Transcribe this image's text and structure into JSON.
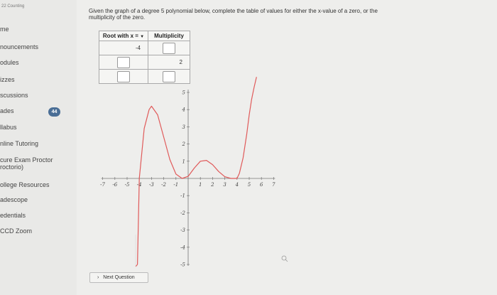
{
  "sidebar": {
    "course": "22 Counting",
    "items": [
      {
        "label": "me",
        "top": 36
      },
      {
        "label": "nouncements",
        "top": 61
      },
      {
        "label": "odules",
        "top": 83
      },
      {
        "label": "izzes",
        "top": 107
      },
      {
        "label": "scussions",
        "top": 129
      },
      {
        "label": "ades",
        "top": 151
      },
      {
        "label": "llabus",
        "top": 174
      },
      {
        "label": "nline Tutoring",
        "top": 197
      },
      {
        "label": "cure Exam Proctor",
        "top": 220
      },
      {
        "label": "roctorio)",
        "top": 230
      },
      {
        "label": "ollege Resources",
        "top": 255
      },
      {
        "label": "adescope",
        "top": 276
      },
      {
        "label": "edentials",
        "top": 298
      },
      {
        "label": "CCD Zoom",
        "top": 320
      }
    ],
    "grades_badge": "44"
  },
  "question": {
    "text": "Given the graph of a degree 5 polynomial below, complete the table of values for either the x-value of a zero, or the multiplicity of the zero."
  },
  "table": {
    "header_root": "Root with x =",
    "header_mult": "Multiplicity",
    "row1_root": "-4",
    "row2_mult": "2"
  },
  "chart_data": {
    "type": "line",
    "xlim": [
      -7,
      7
    ],
    "ylim": [
      -5,
      5
    ],
    "x_ticks": [
      "-7",
      "-6",
      "-5",
      "-4",
      "-3",
      "-2",
      "-1",
      "1",
      "2",
      "3",
      "4",
      "5",
      "6",
      "7"
    ],
    "y_ticks": [
      "5",
      "4",
      "3",
      "2",
      "1",
      "-1",
      "-2",
      "-3",
      "-4",
      "-5"
    ],
    "series": [
      {
        "color": "#e05a5a",
        "x": [
          -4.15,
          -4.0,
          -3.6,
          -3.2,
          -3.0,
          -2.5,
          -2.0,
          -1.5,
          -1.0,
          -0.5,
          0.0,
          0.5,
          1.0,
          1.5,
          2.0,
          2.5,
          3.0,
          3.5,
          4.0,
          4.2,
          4.5,
          4.8,
          5.0,
          5.2,
          5.4,
          5.6
        ],
        "y": [
          -5.0,
          0.0,
          2.9,
          4.0,
          4.2,
          3.7,
          2.4,
          1.1,
          0.25,
          0.0,
          0.12,
          0.6,
          1.0,
          1.05,
          0.8,
          0.4,
          0.1,
          0.0,
          0.0,
          0.3,
          1.2,
          2.6,
          3.7,
          4.6,
          5.3,
          5.9
        ]
      }
    ]
  },
  "next_button": "Next Question"
}
